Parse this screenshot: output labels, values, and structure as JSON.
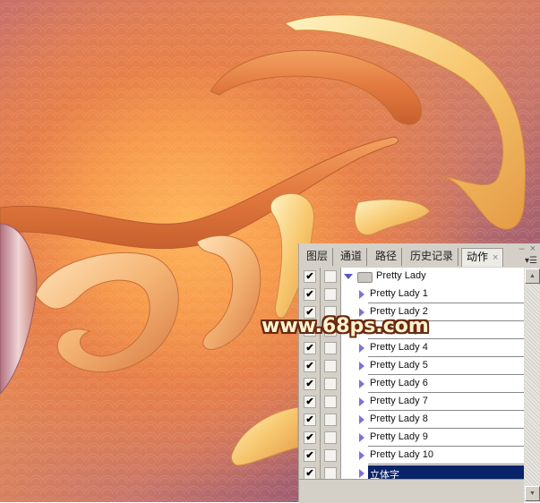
{
  "watermark": "www.68ps.com",
  "panel": {
    "tabs": [
      {
        "label": "图层",
        "active": false
      },
      {
        "label": "通道",
        "active": false
      },
      {
        "label": "路径",
        "active": false
      },
      {
        "label": "历史记录",
        "active": false
      },
      {
        "label": "动作",
        "active": true
      }
    ],
    "tab_close_glyph": "×",
    "minimize_glyph": "–",
    "close_glyph": "×",
    "menu_glyph": "▾☰",
    "scroll_up_glyph": "▲",
    "scroll_down_glyph": "▼",
    "checkmark": "✔",
    "group": {
      "label": "Pretty Lady",
      "checked": true,
      "expanded": true
    },
    "actions": [
      {
        "label": "Pretty Lady 1",
        "checked": true,
        "selected": false
      },
      {
        "label": "Pretty Lady 2",
        "checked": true,
        "selected": false
      },
      {
        "label": "Pretty Lady 3",
        "checked": true,
        "selected": false
      },
      {
        "label": "Pretty Lady 4",
        "checked": true,
        "selected": false
      },
      {
        "label": "Pretty Lady 5",
        "checked": true,
        "selected": false
      },
      {
        "label": "Pretty Lady 6",
        "checked": true,
        "selected": false
      },
      {
        "label": "Pretty Lady 7",
        "checked": true,
        "selected": false
      },
      {
        "label": "Pretty Lady 8",
        "checked": true,
        "selected": false
      },
      {
        "label": "Pretty Lady 9",
        "checked": true,
        "selected": false
      },
      {
        "label": "Pretty Lady 10",
        "checked": true,
        "selected": false
      },
      {
        "label": "立体字",
        "checked": true,
        "selected": true
      }
    ]
  },
  "colors": {
    "selection": "#0a246a",
    "panel_bg": "#d4d0c8",
    "triangle": "#7a74d8"
  }
}
